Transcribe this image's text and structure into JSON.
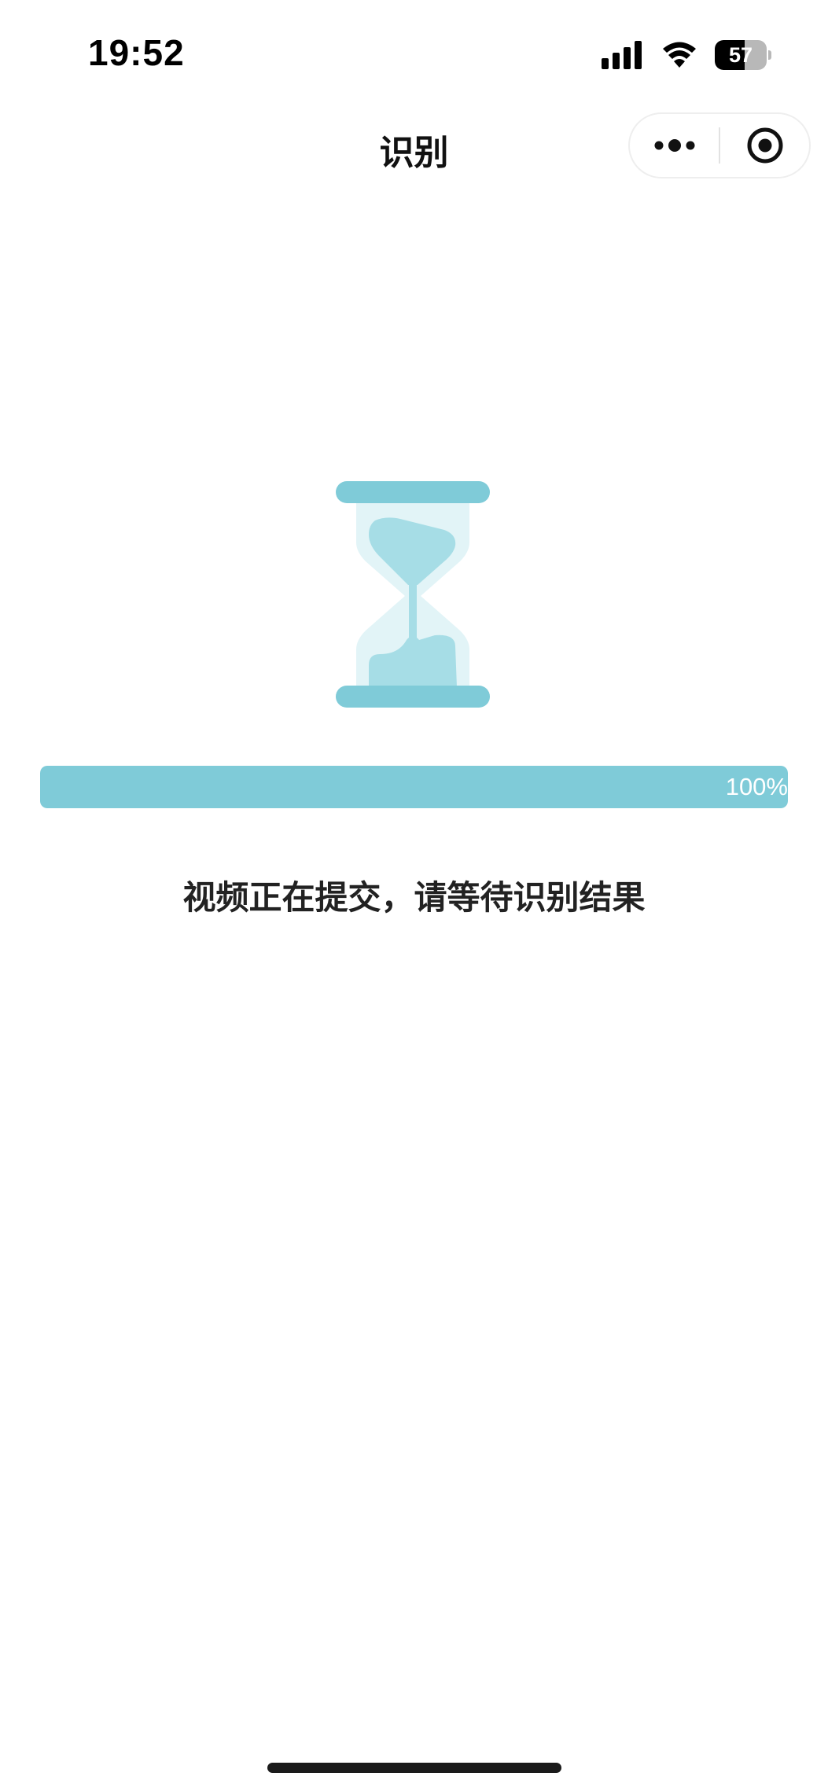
{
  "status_bar": {
    "time": "19:52",
    "battery_level": "57",
    "battery_fraction": 0.57,
    "signal_icon": "cellular-signal-icon",
    "wifi_icon": "wifi-icon"
  },
  "nav": {
    "title": "识别",
    "more_icon": "more-dots-icon",
    "close_icon": "target-circle-icon"
  },
  "progress": {
    "value_fraction": 1.0,
    "label": "100%"
  },
  "message": "视频正在提交，请等待识别结果",
  "colors": {
    "accent": "#7fcbd8",
    "accent_light": "#a6dde6",
    "accent_pale": "#e2f4f7",
    "text": "#222222"
  }
}
